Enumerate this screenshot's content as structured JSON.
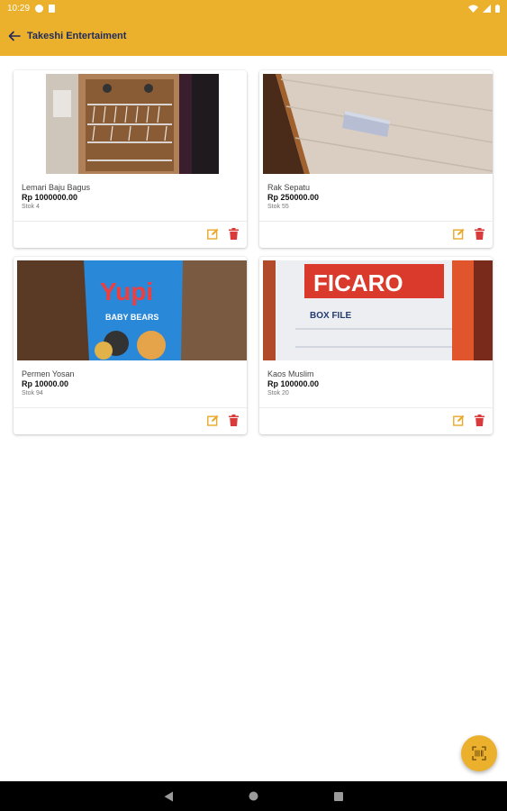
{
  "status": {
    "time": "10:29"
  },
  "app_bar": {
    "title": "Takeshi Entertaiment"
  },
  "products": [
    {
      "name": "Lemari Baju Bagus",
      "price": "Rp 1000000.00",
      "stock": "Stok 4"
    },
    {
      "name": "Rak Sepatu",
      "price": "Rp 250000.00",
      "stock": "Stok 55"
    },
    {
      "name": "Permen Yosan",
      "price": "Rp 10000.00",
      "stock": "Stok 94"
    },
    {
      "name": "Kaos Muslim",
      "price": "Rp 100000.00",
      "stock": "Stok 20"
    }
  ],
  "images": {
    "yupi_text": "Yupi",
    "yupi_sub": "BABY BEARS",
    "ficaro_text": "FICARO",
    "boxfile_text": "BOX FILE"
  },
  "colors": {
    "primary": "#ebb12d",
    "title": "#1f2a5c",
    "edit": "#e9a829",
    "delete": "#d93b3b"
  }
}
